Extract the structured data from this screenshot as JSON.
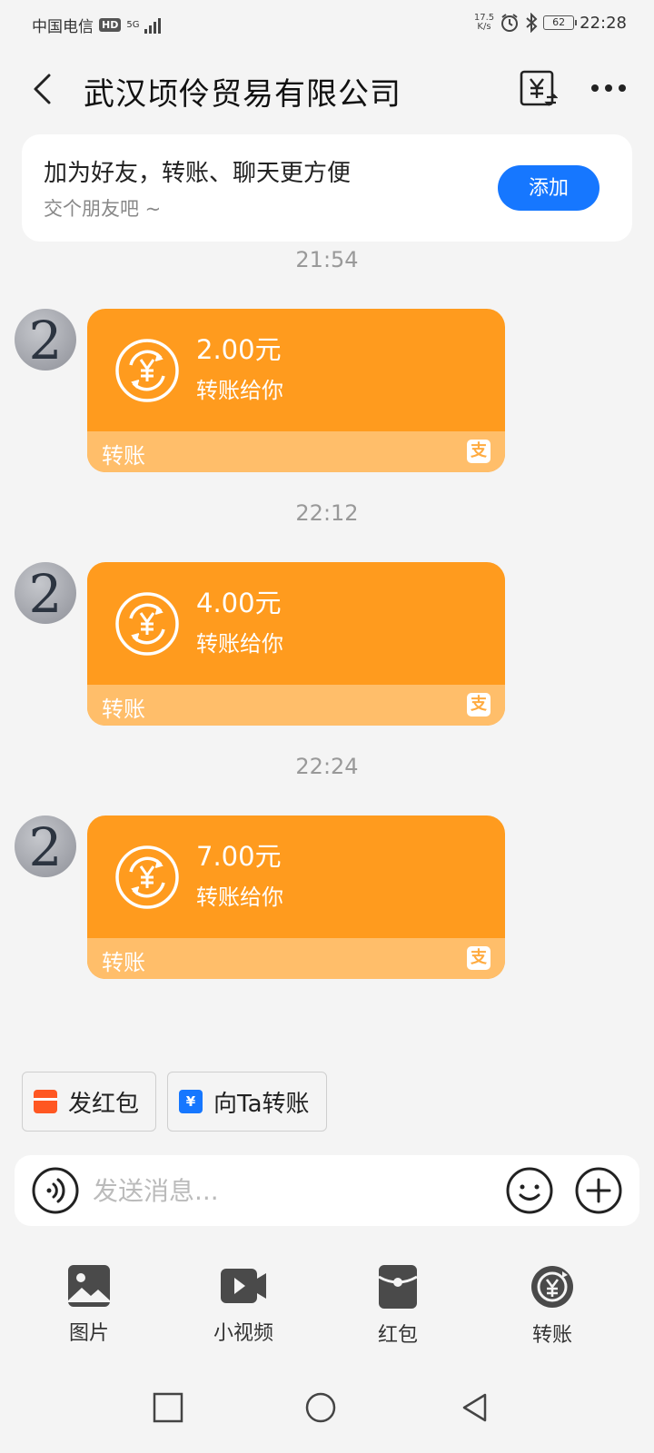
{
  "status_bar": {
    "carrier": "中国电信",
    "hd": "HD",
    "network": "5G",
    "speed_value": "17.5",
    "speed_unit": "K/s",
    "battery": "62",
    "time": "22:28"
  },
  "header": {
    "title": "武汉顷伶贸易有限公司"
  },
  "add_friend": {
    "headline": "加为好友，转账、聊天更方便",
    "subtext": "交个朋友吧 ~",
    "button_label": "添加"
  },
  "messages": [
    {
      "time": "21:54",
      "avatar_text": "2",
      "amount": "2.00元",
      "desc": "转账给你",
      "label": "转账",
      "badge": "支"
    },
    {
      "time": "22:12",
      "avatar_text": "2",
      "amount": "4.00元",
      "desc": "转账给你",
      "label": "转账",
      "badge": "支"
    },
    {
      "time": "22:24",
      "avatar_text": "2",
      "amount": "7.00元",
      "desc": "转账给你",
      "label": "转账",
      "badge": "支"
    }
  ],
  "quick_actions": {
    "red_packet": "发红包",
    "transfer": "向Ta转账",
    "transfer_icon": "¥"
  },
  "input": {
    "placeholder": "发送消息..."
  },
  "tools": [
    {
      "label": "图片",
      "icon": "image-icon"
    },
    {
      "label": "小视频",
      "icon": "video-icon"
    },
    {
      "label": "红包",
      "icon": "red-packet-icon"
    },
    {
      "label": "转账",
      "icon": "transfer-icon"
    }
  ],
  "colors": {
    "accent_blue": "#1677ff",
    "transfer_orange": "#ff9b1e",
    "transfer_light": "#ffbe6a"
  }
}
